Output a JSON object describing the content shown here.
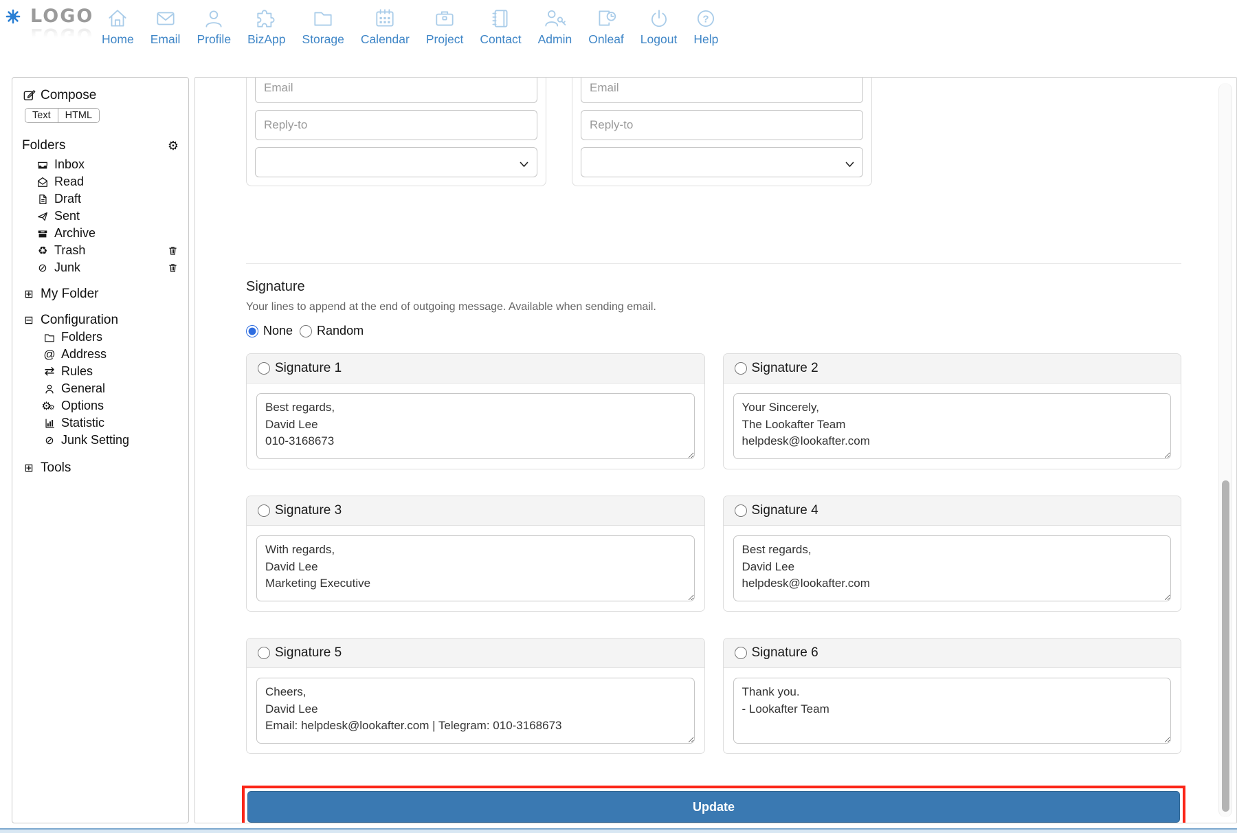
{
  "nav": {
    "logo_text": "LOGO",
    "items": [
      {
        "label": "Home",
        "icon": "home-icon"
      },
      {
        "label": "Email",
        "icon": "email-icon"
      },
      {
        "label": "Profile",
        "icon": "profile-icon"
      },
      {
        "label": "BizApp",
        "icon": "bizapp-icon"
      },
      {
        "label": "Storage",
        "icon": "storage-icon"
      },
      {
        "label": "Calendar",
        "icon": "calendar-icon"
      },
      {
        "label": "Project",
        "icon": "project-icon"
      },
      {
        "label": "Contact",
        "icon": "contact-icon"
      },
      {
        "label": "Admin",
        "icon": "admin-icon"
      },
      {
        "label": "Onleaf",
        "icon": "onleaf-icon"
      },
      {
        "label": "Logout",
        "icon": "logout-icon"
      },
      {
        "label": "Help",
        "icon": "help-icon"
      }
    ]
  },
  "sidebar": {
    "compose_label": "Compose",
    "mode_buttons": [
      {
        "label": "Text"
      },
      {
        "label": "HTML"
      }
    ],
    "folders_header": "Folders",
    "folders": [
      {
        "label": "Inbox",
        "icon": "inbox-icon"
      },
      {
        "label": "Read",
        "icon": "read-icon"
      },
      {
        "label": "Draft",
        "icon": "draft-icon"
      },
      {
        "label": "Sent",
        "icon": "sent-icon"
      },
      {
        "label": "Archive",
        "icon": "archive-icon"
      },
      {
        "label": "Trash",
        "icon": "recycle-icon",
        "action_icon": "trash-bin-icon"
      },
      {
        "label": "Junk",
        "icon": "block-icon",
        "action_icon": "trash-bin-icon"
      }
    ],
    "my_folder_label": "My Folder",
    "configuration_label": "Configuration",
    "configuration_items": [
      {
        "label": "Folders",
        "icon": "folder-icon"
      },
      {
        "label": "Address",
        "icon": "at-icon"
      },
      {
        "label": "Rules",
        "icon": "rules-icon"
      },
      {
        "label": "General",
        "icon": "person-icon"
      },
      {
        "label": "Options",
        "icon": "gears-icon"
      },
      {
        "label": "Statistic",
        "icon": "chart-icon"
      },
      {
        "label": "Junk Setting",
        "icon": "block-icon"
      }
    ],
    "tools_label": "Tools"
  },
  "main": {
    "identity_forms": [
      {
        "email_placeholder": "Email",
        "replyto_placeholder": "Reply-to"
      },
      {
        "email_placeholder": "Email",
        "replyto_placeholder": "Reply-to"
      }
    ],
    "signature_section": {
      "title": "Signature",
      "description": "Your lines to append at the end of outgoing message. Available when sending email.",
      "modes": [
        {
          "label": "None",
          "selected": true
        },
        {
          "label": "Random",
          "selected": false
        }
      ],
      "signatures": [
        {
          "title": "Signature 1",
          "content": "Best regards,\nDavid Lee\n010-3168673"
        },
        {
          "title": "Signature 2",
          "content": "Your Sincerely,\nThe Lookafter Team\nhelpdesk@lookafter.com"
        },
        {
          "title": "Signature 3",
          "content": "With regards,\nDavid Lee\nMarketing Executive"
        },
        {
          "title": "Signature 4",
          "content": "Best regards,\nDavid Lee\nhelpdesk@lookafter.com"
        },
        {
          "title": "Signature 5",
          "content": "Cheers,\nDavid Lee\nEmail: helpdesk@lookafter.com | Telegram: 010-3168673"
        },
        {
          "title": "Signature 6",
          "content": "Thank you.\n- Lookafter Team"
        }
      ]
    },
    "update_button_label": "Update"
  },
  "colors": {
    "nav_label_blue": "#3f86c7",
    "nav_icon_blue": "#a9cce9",
    "button_blue": "#3a79b2",
    "highlight_red": "#fb2517"
  }
}
